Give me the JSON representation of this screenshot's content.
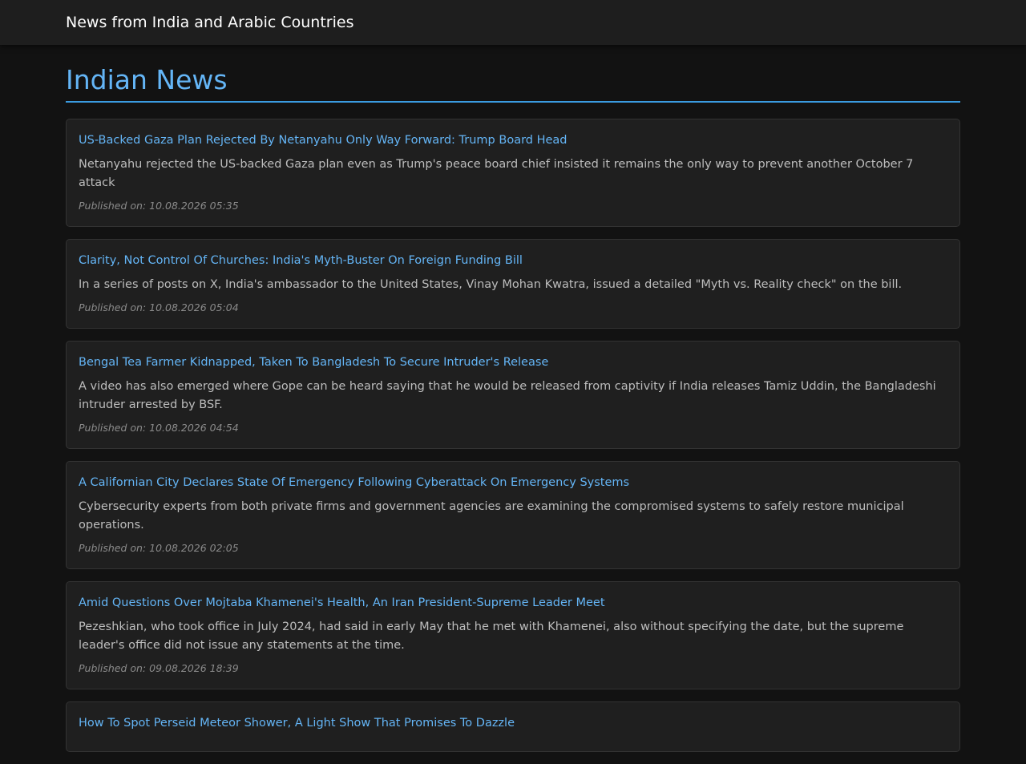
{
  "header": {
    "title": "News from India and Arabic Countries"
  },
  "section": {
    "title": "Indian News"
  },
  "articles": [
    {
      "title": "US-Backed Gaza Plan Rejected By Netanyahu Only Way Forward: Trump Board Head",
      "description": "Netanyahu rejected the US-backed Gaza plan even as Trump's peace board chief insisted it remains the only way to prevent another October 7 attack",
      "date": "Published on: 10.08.2026 05:35"
    },
    {
      "title": "Clarity, Not Control Of Churches: India's Myth-Buster On Foreign Funding Bill",
      "description": "In a series of posts on X, India's ambassador to the United States, Vinay Mohan Kwatra, issued a detailed \"Myth vs. Reality check\" on the bill.",
      "date": "Published on: 10.08.2026 05:04"
    },
    {
      "title": "Bengal Tea Farmer Kidnapped, Taken To Bangladesh To Secure Intruder's Release",
      "description": "A video has also emerged where Gope can be heard saying that he would be released from captivity if India releases Tamiz Uddin, the Bangladeshi intruder arrested by BSF.",
      "date": "Published on: 10.08.2026 04:54"
    },
    {
      "title": "A Californian City Declares State Of Emergency Following Cyberattack On Emergency Systems",
      "description": "Cybersecurity experts from both private firms and government agencies are examining the compromised systems to safely restore municipal operations.",
      "date": "Published on: 10.08.2026 02:05"
    },
    {
      "title": "Amid Questions Over Mojtaba Khamenei's Health, An Iran President-Supreme Leader Meet",
      "description": "Pezeshkian, who took office in July 2024, had said in early May that he met with Khamenei, also without specifying the date, but the supreme leader's office did not issue any statements at the time.",
      "date": "Published on: 09.08.2026 18:39"
    },
    {
      "title": "How To Spot Perseid Meteor Shower, A Light Show That Promises To Dazzle",
      "description": "",
      "date": ""
    }
  ]
}
